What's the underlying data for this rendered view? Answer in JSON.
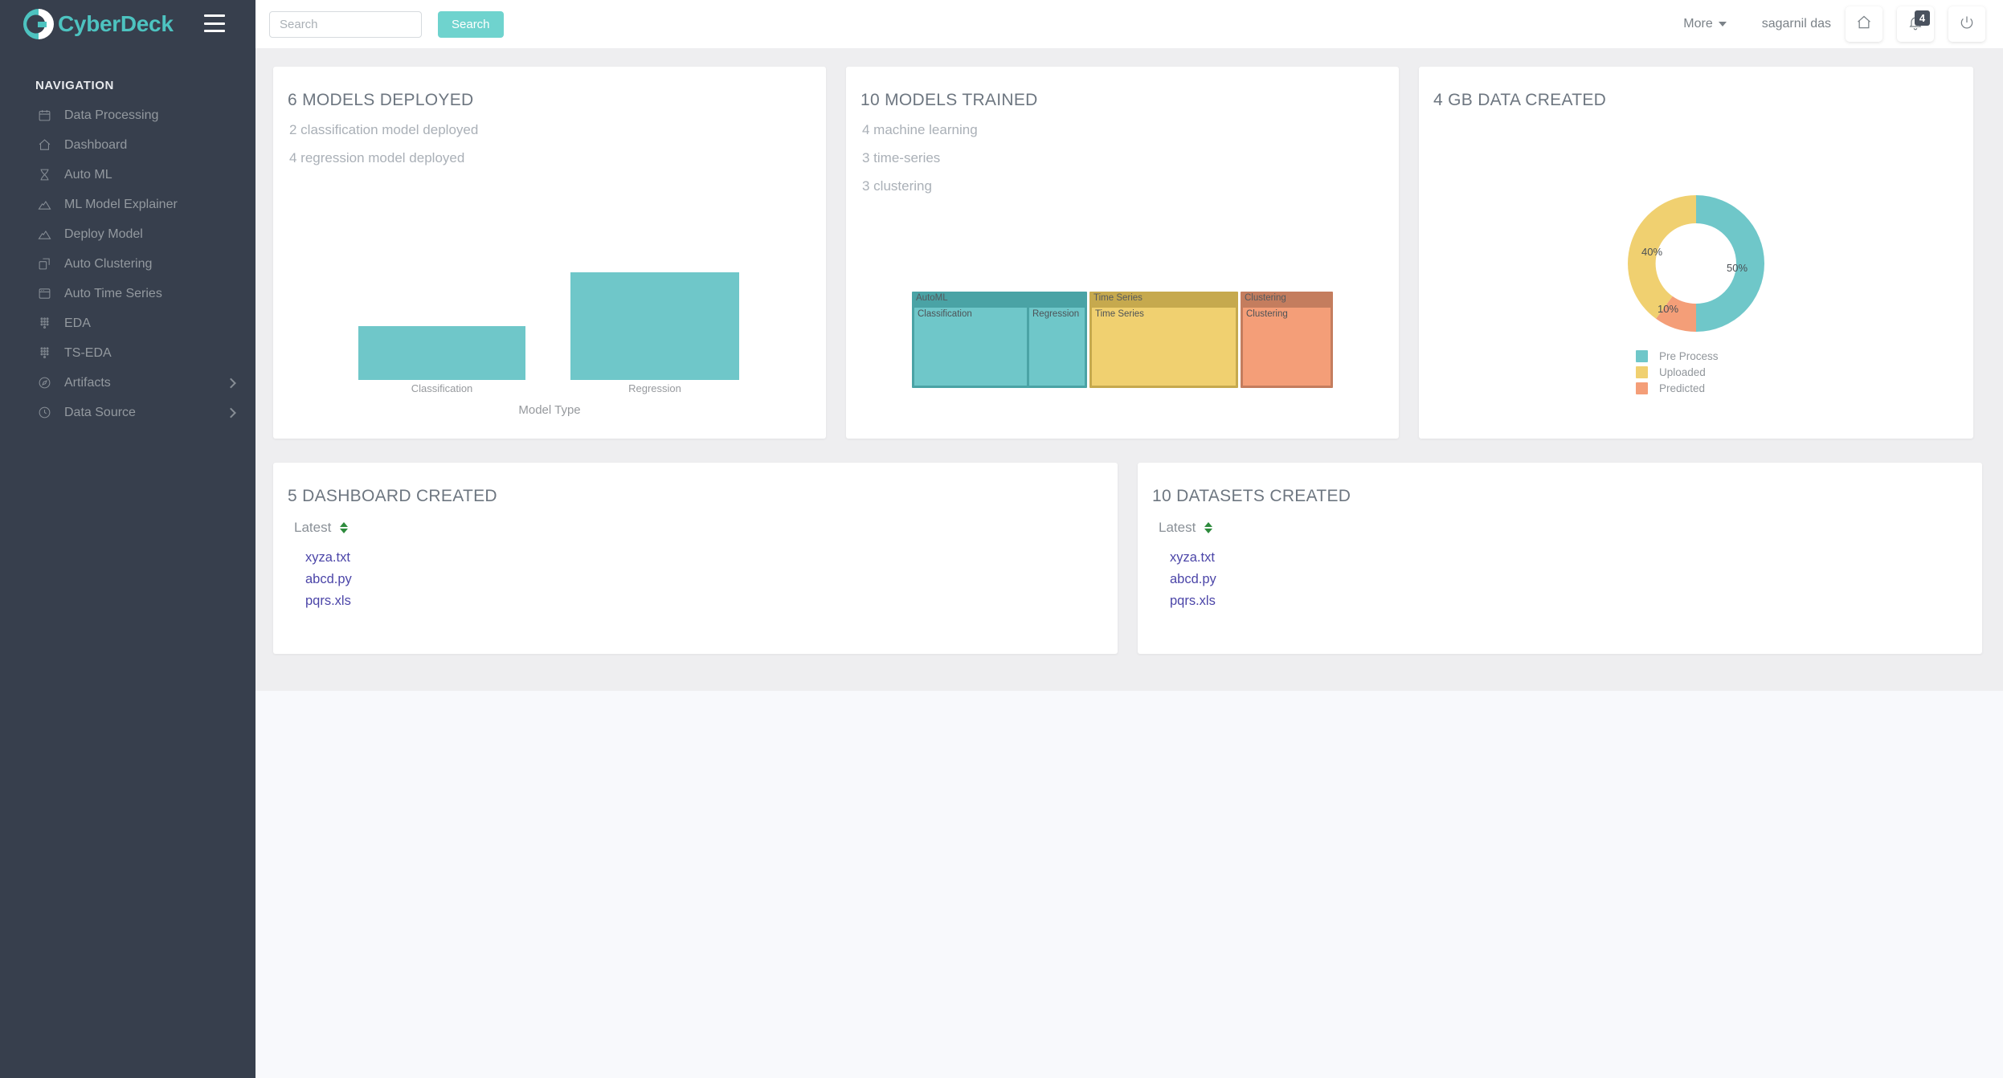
{
  "brand": {
    "name": "CyberDeck",
    "logo_icon": "cyberdeck-logo-icon"
  },
  "sidebar": {
    "nav_heading": "NAVIGATION",
    "items": [
      {
        "label": "Data Processing",
        "icon": "calendar-icon",
        "has_caret": false
      },
      {
        "label": "Dashboard",
        "icon": "home-icon",
        "has_caret": false
      },
      {
        "label": "Auto ML",
        "icon": "dna-icon",
        "has_caret": false
      },
      {
        "label": "ML Model Explainer",
        "icon": "mountains-icon",
        "has_caret": false
      },
      {
        "label": "Deploy Model",
        "icon": "mountains-icon",
        "has_caret": false
      },
      {
        "label": "Auto Clustering",
        "icon": "copy-icon",
        "has_caret": false
      },
      {
        "label": "Auto Time Series",
        "icon": "window-icon",
        "has_caret": false
      },
      {
        "label": "EDA",
        "icon": "dots-grid-icon",
        "has_caret": false
      },
      {
        "label": "TS-EDA",
        "icon": "dots-grid-icon",
        "has_caret": false
      },
      {
        "label": "Artifacts",
        "icon": "compass-icon",
        "has_caret": true
      },
      {
        "label": "Data Source",
        "icon": "clock-icon",
        "has_caret": true
      }
    ]
  },
  "header": {
    "search": {
      "value": "",
      "placeholder": "Search"
    },
    "search_button": "Search",
    "more_label": "More",
    "username": "sagarnil das",
    "home_icon": "home-icon",
    "bell_icon": "bell-icon",
    "notification_count": "4",
    "power_icon": "power-icon"
  },
  "cards": {
    "models_deployed": {
      "title": "6 MODELS DEPLOYED",
      "sub": [
        "2 classification model deployed",
        "4 regression model deployed"
      ]
    },
    "models_trained": {
      "title": "10 MODELS TRAINED",
      "sub": [
        "4 machine learning",
        "3 time-series",
        "3 clustering"
      ]
    },
    "data_created": {
      "title": "4 GB DATA CREATED"
    },
    "dashboard_created": {
      "title": "5 DASHBOARD CREATED",
      "sort_label": "Latest",
      "sort_icon": "sort-updown-icon",
      "files": [
        "xyza.txt",
        "abcd.py",
        "pqrs.xls"
      ]
    },
    "datasets_created": {
      "title": "10 DATASETS CREATED",
      "sort_label": "Latest",
      "sort_icon": "sort-updown-icon",
      "files": [
        "xyza.txt",
        "abcd.py",
        "pqrs.xls"
      ]
    }
  },
  "chart_data": [
    {
      "type": "bar",
      "title": "",
      "categories": [
        "Classification",
        "Regression"
      ],
      "values": [
        2,
        4
      ],
      "xlabel": "Model Type",
      "ylabel": "",
      "ylim": [
        0,
        4.4
      ],
      "grid": false,
      "color": "#6fc7c9"
    },
    {
      "type": "treemap",
      "title": "",
      "groups": [
        {
          "name": "AutoML",
          "value": 4,
          "header_color": "#4aa3a5",
          "children": [
            {
              "name": "Classification",
              "value": 2,
              "color": "#6fc7c9"
            },
            {
              "name": "Regression",
              "value": 2,
              "color": "#6fc7c9"
            }
          ]
        },
        {
          "name": "Time Series",
          "value": 3,
          "header_color": "#c6a94e",
          "children": [
            {
              "name": "Time Series",
              "value": 3,
              "color": "#f0d070"
            }
          ]
        },
        {
          "name": "Clustering",
          "value": 3,
          "header_color": "#c47d5e",
          "children": [
            {
              "name": "Clustering",
              "value": 3,
              "color": "#f49e78"
            }
          ]
        }
      ]
    },
    {
      "type": "pie",
      "variant": "donut",
      "title": "",
      "labels": [
        "Pre Process",
        "Uploaded",
        "Predicted"
      ],
      "values": [
        50,
        40,
        10
      ],
      "display_values": [
        "50%",
        "40%",
        "10%"
      ],
      "colors": [
        "#6fc7c9",
        "#f0d070",
        "#f49e78"
      ],
      "legend_position": "bottom"
    }
  ]
}
